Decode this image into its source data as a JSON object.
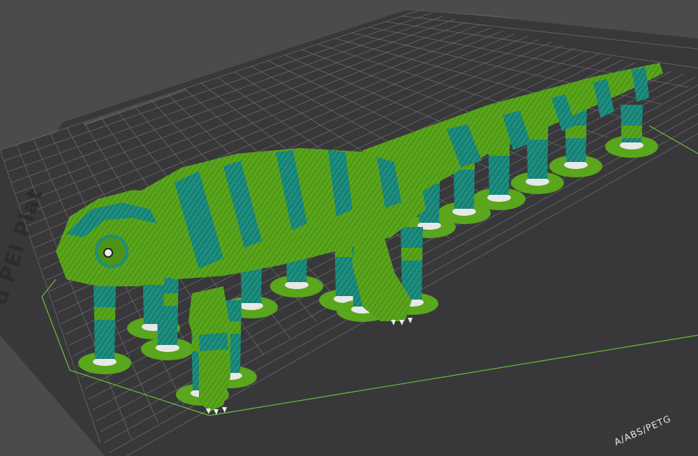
{
  "viewport": {
    "name": "3D slicer preview",
    "plate_text_left": "d PEI Plat",
    "plate_text_right": "A/ABS/PETG"
  },
  "colors": {
    "background": "#4b4b4d",
    "bed": "#38383a",
    "grid": "#6a6a6c",
    "filament_green": "#5aa61c",
    "filament_teal": "#1c8f80",
    "travel_line": "#6cc23a"
  },
  "model": {
    "object": "lizard",
    "supports": "tree"
  }
}
